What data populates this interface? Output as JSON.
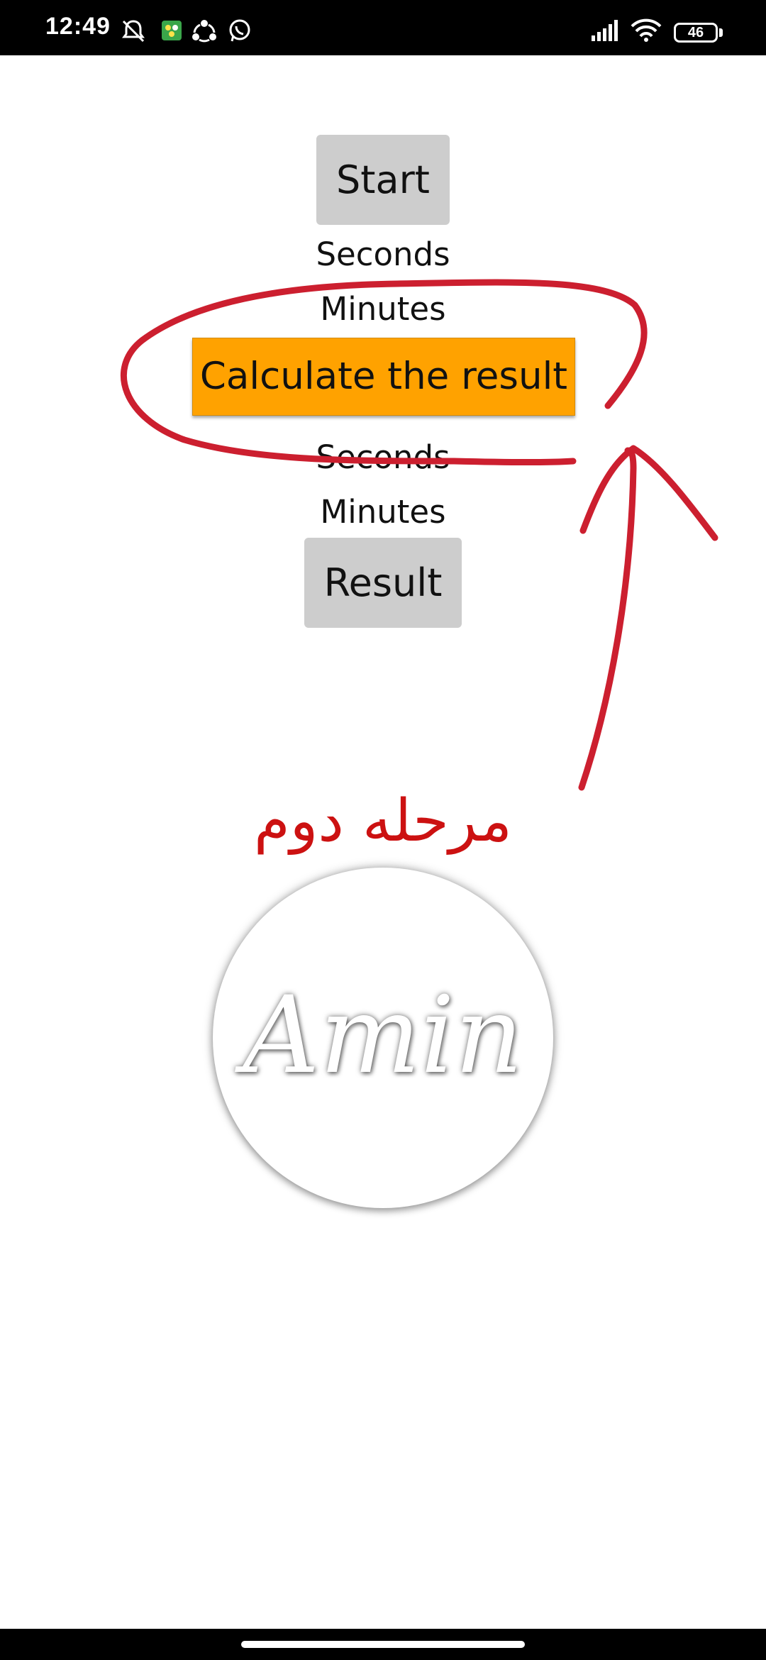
{
  "status_bar": {
    "time": "12:49",
    "battery": "46",
    "icons": [
      "mute-bell-icon",
      "game-app-icon",
      "shareit-icon",
      "whatsapp-icon",
      "signal-icon",
      "wifi-icon",
      "battery-icon"
    ]
  },
  "main": {
    "start_label": "Start",
    "seconds_label_1": "Seconds",
    "minutes_label_1": "Minutes",
    "calculate_label": "Calculate the result",
    "seconds_label_2": "Seconds",
    "minutes_label_2": "Minutes",
    "result_label": "Result"
  },
  "annotation": {
    "caption": "مرحله دوم",
    "color": "#cc1f2f"
  },
  "logo": {
    "text": "Amin"
  },
  "colors": {
    "accent": "#ffa200",
    "button_gray": "#cdcdcd"
  }
}
